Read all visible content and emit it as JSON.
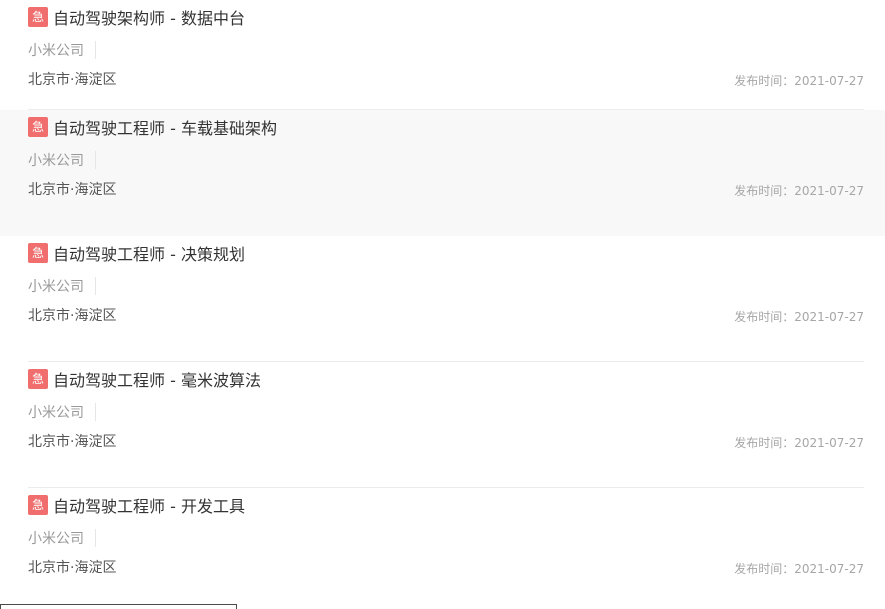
{
  "jobs": [
    {
      "urgent_label": "急",
      "title": "自动驾驶架构师 - 数据中台",
      "company": "小米公司",
      "location": "北京市·海淀区",
      "publish_label": "发布时间：",
      "publish_date": "2021-07-27",
      "highlighted": false
    },
    {
      "urgent_label": "急",
      "title": "自动驾驶工程师 - 车载基础架构",
      "company": "小米公司",
      "location": "北京市·海淀区",
      "publish_label": "发布时间：",
      "publish_date": "2021-07-27",
      "highlighted": true
    },
    {
      "urgent_label": "急",
      "title": "自动驾驶工程师 - 决策规划",
      "company": "小米公司",
      "location": "北京市·海淀区",
      "publish_label": "发布时间：",
      "publish_date": "2021-07-27",
      "highlighted": false
    },
    {
      "urgent_label": "急",
      "title": "自动驾驶工程师 - 毫米波算法",
      "company": "小米公司",
      "location": "北京市·海淀区",
      "publish_label": "发布时间：",
      "publish_date": "2021-07-27",
      "highlighted": false
    },
    {
      "urgent_label": "急",
      "title": "自动驾驶工程师 - 开发工具",
      "company": "小米公司",
      "location": "北京市·海淀区",
      "publish_label": "发布时间：",
      "publish_date": "2021-07-27",
      "highlighted": false
    }
  ],
  "colors": {
    "urgent_badge": "#f06e6e",
    "hover_background": "#f8f8f8",
    "title_text": "#333333",
    "muted_text": "#999999"
  }
}
